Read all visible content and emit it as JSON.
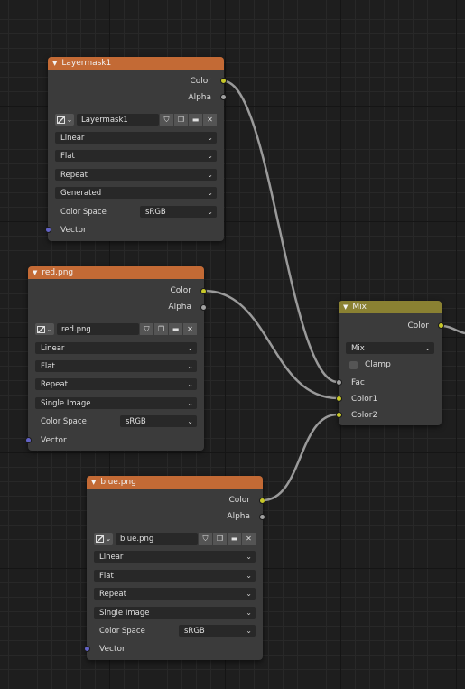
{
  "nodes": {
    "layermask": {
      "title": "Layermask1",
      "outputs": [
        "Color",
        "Alpha"
      ],
      "image_name": "Layermask1",
      "interpolation": "Linear",
      "projection": "Flat",
      "extension": "Repeat",
      "source": "Generated",
      "color_space_label": "Color Space",
      "color_space": "sRGB",
      "input_vector": "Vector"
    },
    "red": {
      "title": "red.png",
      "outputs": [
        "Color",
        "Alpha"
      ],
      "image_name": "red.png",
      "interpolation": "Linear",
      "projection": "Flat",
      "extension": "Repeat",
      "source": "Single Image",
      "color_space_label": "Color Space",
      "color_space": "sRGB",
      "input_vector": "Vector"
    },
    "blue": {
      "title": "blue.png",
      "outputs": [
        "Color",
        "Alpha"
      ],
      "image_name": "blue.png",
      "interpolation": "Linear",
      "projection": "Flat",
      "extension": "Repeat",
      "source": "Single Image",
      "color_space_label": "Color Space",
      "color_space": "sRGB",
      "input_vector": "Vector"
    },
    "mix": {
      "title": "Mix",
      "output_color": "Color",
      "blend_type": "Mix",
      "clamp_label": "Clamp",
      "inputs": [
        "Fac",
        "Color1",
        "Color2"
      ]
    }
  },
  "icons": {
    "collapse": "▼",
    "chevron": "⌄",
    "fake_user": "shield-icon",
    "duplicate": "copy-icon",
    "open": "folder-icon",
    "unlink": "close-icon"
  },
  "colors": {
    "texture_header": "#c36a35",
    "mix_header": "#8a8132",
    "color_socket": "#c7c729",
    "float_socket": "#a1a1a1",
    "vector_socket": "#6363c7"
  }
}
